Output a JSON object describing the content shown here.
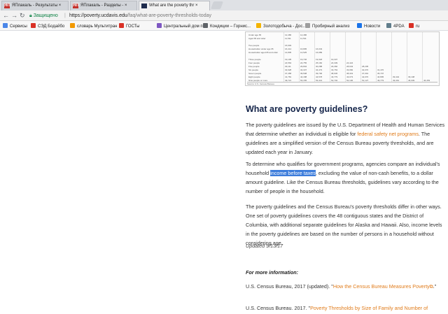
{
  "browser": {
    "tabs": [
      {
        "label": "ЯПлакаль - Результаты ×",
        "active": false,
        "favicon": "ЯП"
      },
      {
        "label": "ЯПлакаль - Разделы - ×",
        "active": false,
        "favicon": "ЯП"
      },
      {
        "label": "What are the poverty thr ×",
        "active": true,
        "favicon": ""
      }
    ],
    "secure_label": "Защищено",
    "url_host": "https://poverty.ucdavis.edu",
    "url_path": "/faq/what-are-poverty-thresholds-today"
  },
  "bookmarks": [
    {
      "label": "Сервисы",
      "icon": "apps-icon",
      "color": "#4a86e8"
    },
    {
      "label": "СЭД Бодайбо",
      "icon": "folder-icon",
      "color": "#d93025"
    },
    {
      "label": "словарь Мультитран",
      "icon": "dictionary-icon",
      "color": "#f29900"
    },
    {
      "label": "ГОСТы",
      "icon": "page-icon",
      "color": "#d93025"
    },
    {
      "label": "Центральный дом п...",
      "icon": "page-icon",
      "color": "#7e57c2"
    },
    {
      "label": "Кондиции – Горнис...",
      "icon": "diamond-icon",
      "color": "#5f6368"
    },
    {
      "label": "Золотодобыча - Дос...",
      "icon": "gold-icon",
      "color": "#f4b400"
    },
    {
      "label": "Пробирный анализ",
      "icon": "page-icon",
      "color": "#9e9e9e"
    },
    {
      "label": "Новости",
      "icon": "news-icon",
      "color": "#1a73e8"
    },
    {
      "label": "4PDA",
      "icon": "forum-icon",
      "color": "#607d8b"
    },
    {
      "label": "ru",
      "icon": "page-icon",
      "color": "#d93025"
    }
  ],
  "table_image": {
    "rows": [
      {
        "label": "Under age 65",
        "values": [
          "12,486",
          "12,486"
        ]
      },
      {
        "label": "Aged 65 and older",
        "values": [
          "11,511",
          "11,511"
        ]
      },
      {
        "label": "",
        "values": []
      },
      {
        "label": "Two people",
        "values": [
          "15,993"
        ]
      },
      {
        "label": "Householder under age 65",
        "values": [
          "16,414",
          "16,895",
          "16,043"
        ]
      },
      {
        "label": "Householder aged 65 and older",
        "values": [
          "14,805",
          "14,525",
          "16,989"
        ]
      },
      {
        "label": "",
        "values": []
      },
      {
        "label": "Three people",
        "values": [
          "19,105",
          "19,746",
          "19,318",
          "19,337"
        ]
      },
      {
        "label": "Four people",
        "values": [
          "24,563",
          "24,755",
          "25,160",
          "24,339",
          "24,424"
        ]
      },
      {
        "label": "Five people",
        "values": [
          "29,111",
          "29,804",
          "30,288",
          "29,360",
          "28,643",
          "28,205"
        ]
      },
      {
        "label": "Six people",
        "values": [
          "32,928",
          "34,337",
          "34,473",
          "33,763",
          "33,082",
          "32,070",
          "31,470"
        ]
      },
      {
        "label": "Seven people",
        "values": [
          "37,458",
          "39,508",
          "39,796",
          "38,945",
          "38,319",
          "37,091",
          "35,707"
        ]
      },
      {
        "label": "Eight people",
        "values": [
          "41,781",
          "44,188",
          "44,578",
          "43,779",
          "43,073",
          "42,070",
          "40,895",
          "39,442",
          "39,108"
        ]
      },
      {
        "label": "Nine people or more",
        "values": [
          "49,721",
          "53,155",
          "53,413",
          "52,702",
          "52,106",
          "51,127",
          "49,779",
          "49,461",
          "46,039",
          "46,453"
        ]
      }
    ],
    "footer": "Source: U.S. Census Bureau."
  },
  "article": {
    "heading": "What are poverty guidelines?",
    "p1_before": "The poverty guidelines are issued by the U.S. Department of Health and Human Services that determine whether an individual is eligible for ",
    "p1_link": "federal safety net programs",
    "p1_after": ". The guidelines are a simplified version of the Census Bureau poverty thresholds, and are updated each year in January.",
    "p2_before": "To determine who qualifies for government programs, agencies compare an individual's household ",
    "p2_highlight": "income before taxes",
    "p2_after": ", excluding the value of non-cash benefits, to a dollar amount guideline. Like the Census Bureau thresholds, guidelines vary according to the number of people in the household.",
    "p3": "The poverty guidelines and the Census Bureau's poverty thresholds differ in other ways. One set of poverty guidelines covers the 48 contiguous states and the District of Columbia, with additional separate guidelines for Alaska and Hawaii. Also, income levels in the poverty guidelines are based on the number of persons in a household without considering age.",
    "updated": "Updated 9/13/17",
    "more_info": "For more information:",
    "ref1_before": "U.S. Census Bureau, 2017 (updated). \"",
    "ref1_link": "How the Census Bureau Measures Poverty",
    "ref1_after": ".\"",
    "ref2_before": "U.S. Census Bureau. 2017. \"",
    "ref2_link": "Poverty Thresholds by Size of Family and Number of"
  }
}
